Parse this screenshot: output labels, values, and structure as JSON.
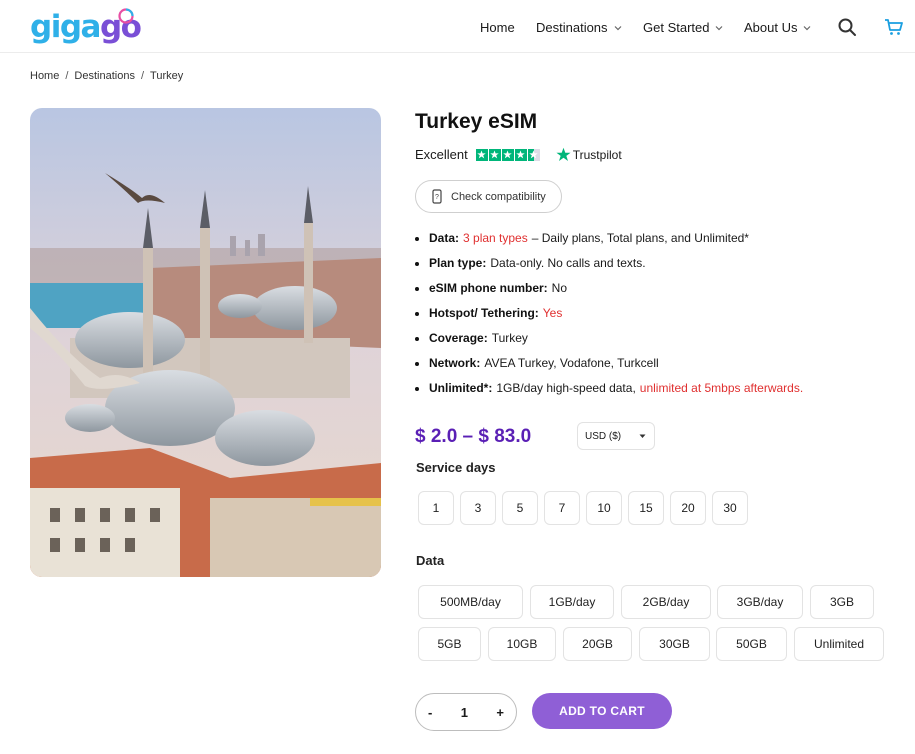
{
  "header": {
    "logo_part1": "giga",
    "logo_part2": "go",
    "nav": [
      {
        "label": "Home"
      },
      {
        "label": "Destinations"
      },
      {
        "label": "Get Started"
      },
      {
        "label": "About Us"
      }
    ]
  },
  "breadcrumb": [
    "Home",
    "Destinations",
    "Turkey"
  ],
  "product": {
    "title": "Turkey eSIM",
    "rating_text": "Excellent",
    "rating_stars": 4.5,
    "trustpilot_label": "Trustpilot",
    "check_compat_label": "Check compatibility",
    "features": [
      {
        "label": "Data:",
        "highlight": "3 plan types",
        "text": "– Daily plans, Total plans, and Unlimited*"
      },
      {
        "label": "Plan type:",
        "text": "Data-only. No calls and texts."
      },
      {
        "label": "eSIM phone number:",
        "text": "No"
      },
      {
        "label": "Hotspot/ Tethering:",
        "highlight": "Yes"
      },
      {
        "label": "Coverage:",
        "text": "Turkey"
      },
      {
        "label": "Network:",
        "text": "AVEA Turkey, Vodafone, Turkcell"
      },
      {
        "label": "Unlimited*:",
        "text": "1GB/day high-speed data,",
        "highlight_after": "unlimited at 5mbps afterwards."
      }
    ],
    "price_range": "$ 2.0 – $ 83.0",
    "currency": "USD ($)",
    "service_days_label": "Service days",
    "service_days": [
      "1",
      "3",
      "5",
      "7",
      "10",
      "15",
      "20",
      "30"
    ],
    "data_label": "Data",
    "data_row1": [
      "500MB/day",
      "1GB/day",
      "2GB/day",
      "3GB/day",
      "3GB"
    ],
    "data_row2": [
      "5GB",
      "10GB",
      "20GB",
      "30GB",
      "50GB",
      "Unlimited"
    ],
    "quantity": "1",
    "qty_minus": "-",
    "qty_plus": "+",
    "add_to_cart": "ADD TO CART"
  },
  "colors": {
    "brand_blue": "#2fb0e8",
    "brand_purple": "#7a4fd6",
    "price_purple": "#5a1fb5",
    "cart_button": "#8f5fd6",
    "trustpilot_green": "#00b67a",
    "highlight_red": "#e03030"
  },
  "icons": [
    "logo-mark-icon",
    "chevron-down-icon",
    "search-icon",
    "cart-icon",
    "phone-icon",
    "trustpilot-star-icon",
    "dropdown-caret-icon"
  ]
}
